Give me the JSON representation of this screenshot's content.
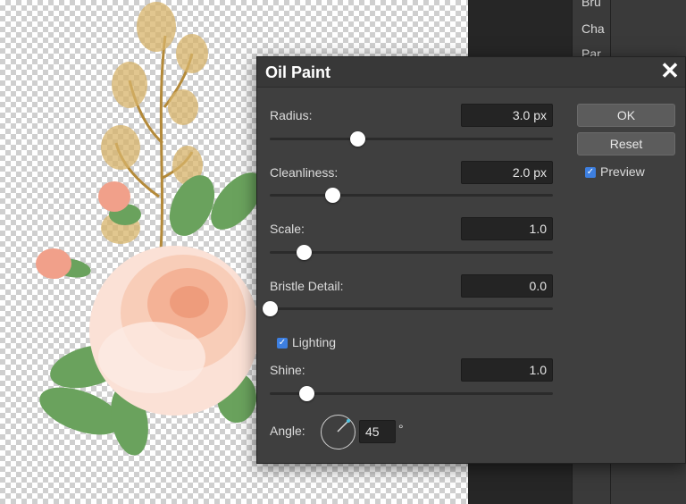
{
  "side_panel": {
    "items": [
      "Bru",
      "Cha",
      "Par"
    ]
  },
  "dialog": {
    "title": "Oil Paint",
    "close_glyph": "✕",
    "fields": {
      "radius": {
        "label": "Radius:",
        "value": "3.0 px",
        "slider_fraction": 0.31
      },
      "cleanliness": {
        "label": "Cleanliness:",
        "value": "2.0 px",
        "slider_fraction": 0.22
      },
      "scale": {
        "label": "Scale:",
        "value": "1.0",
        "slider_fraction": 0.12
      },
      "bristle_detail": {
        "label": "Bristle Detail:",
        "value": "0.0",
        "slider_fraction": 0.0
      },
      "shine": {
        "label": "Shine:",
        "value": "1.0",
        "slider_fraction": 0.13
      }
    },
    "lighting": {
      "label": "Lighting",
      "checked": true
    },
    "angle": {
      "label": "Angle:",
      "value": "45",
      "unit": "°"
    },
    "buttons": {
      "ok": "OK",
      "reset": "Reset"
    },
    "preview": {
      "label": "Preview",
      "checked": true
    }
  },
  "icons": {
    "check": "checkmark-icon",
    "close": "close-icon",
    "dial": "angle-dial-icon"
  },
  "colors": {
    "accent": "#3d7fe0",
    "dialog_bg": "#3f3f3f",
    "input_bg": "#242424"
  }
}
